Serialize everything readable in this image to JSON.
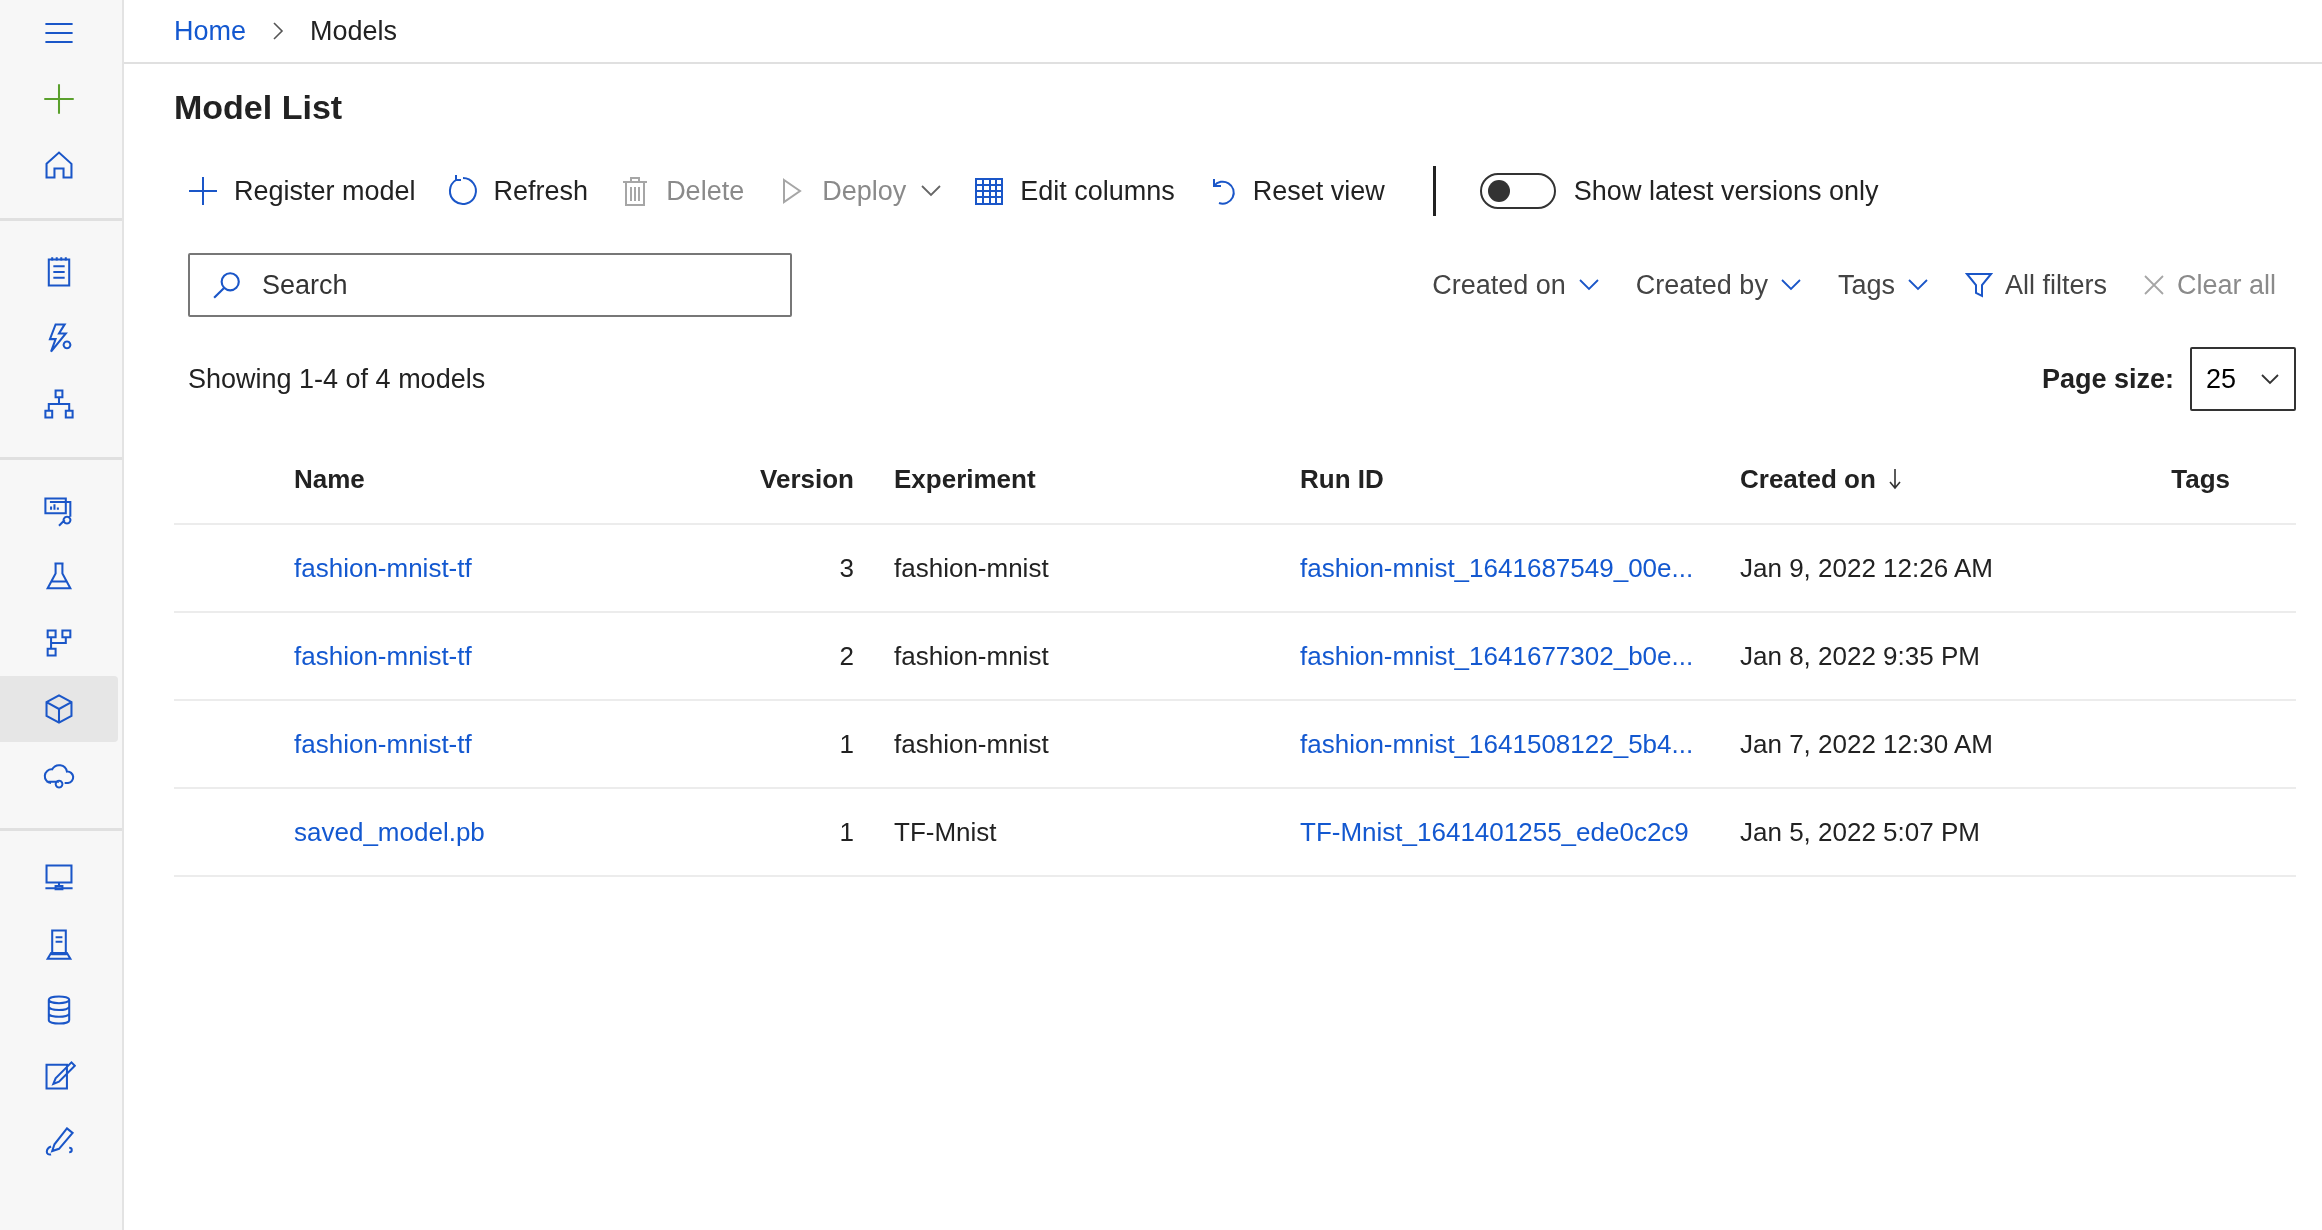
{
  "sidebar": {
    "groups": [
      {
        "items": [
          {
            "selected": false
          },
          {
            "selected": false
          },
          {
            "selected": false
          }
        ]
      },
      {
        "items": [
          {
            "selected": false
          },
          {
            "selected": false
          },
          {
            "selected": false
          }
        ]
      },
      {
        "items": [
          {
            "selected": false
          },
          {
            "selected": false
          },
          {
            "selected": false
          },
          {
            "selected": true
          },
          {
            "selected": false
          }
        ]
      },
      {
        "items": [
          {
            "selected": false
          },
          {
            "selected": false
          },
          {
            "selected": false
          },
          {
            "selected": false
          },
          {
            "selected": false
          }
        ]
      }
    ]
  },
  "breadcrumb": [
    "Home",
    "Models"
  ],
  "page_title": "Model List",
  "toolbar": [
    {
      "kind": "add",
      "label": "Register model",
      "disabled": false,
      "dropdown": false
    },
    {
      "kind": "refresh",
      "label": "Refresh",
      "disabled": false,
      "dropdown": false
    },
    {
      "kind": "delete",
      "label": "Delete",
      "disabled": true,
      "dropdown": false
    },
    {
      "kind": "deploy",
      "label": "Deploy",
      "disabled": true,
      "dropdown": true
    },
    {
      "kind": "columns",
      "label": "Edit columns",
      "disabled": false,
      "dropdown": false
    },
    {
      "kind": "reset",
      "label": "Reset view",
      "disabled": false,
      "dropdown": false
    }
  ],
  "toggle": {
    "label": "Show latest versions only",
    "on": false
  },
  "search": {
    "placeholder": "Search"
  },
  "filters": [
    {
      "kind": "dropdown",
      "label": "Created on",
      "disabled": false
    },
    {
      "kind": "dropdown",
      "label": "Created by",
      "disabled": false
    },
    {
      "kind": "dropdown",
      "label": "Tags",
      "disabled": false
    },
    {
      "kind": "filter",
      "label": "All filters",
      "disabled": false
    },
    {
      "kind": "clear",
      "label": "Clear all",
      "disabled": true
    }
  ],
  "summary": "Showing 1-4 of 4 models",
  "page_size": {
    "label": "Page size:",
    "value": "25"
  },
  "table": {
    "columns": [
      {
        "label": "Name",
        "sorted": false
      },
      {
        "label": "Version",
        "sorted": false
      },
      {
        "label": "Experiment",
        "sorted": false
      },
      {
        "label": "Run ID",
        "sorted": false
      },
      {
        "label": "Created on",
        "sorted": true
      },
      {
        "label": "Tags",
        "sorted": false
      }
    ],
    "rows": [
      {
        "name": "fashion-mnist-tf",
        "version": "3",
        "experiment": "fashion-mnist",
        "run_id": "fashion-mnist_1641687549_00e...",
        "created_on": "Jan 9, 2022 12:26 AM"
      },
      {
        "name": "fashion-mnist-tf",
        "version": "2",
        "experiment": "fashion-mnist",
        "run_id": "fashion-mnist_1641677302_b0e...",
        "created_on": "Jan 8, 2022 9:35 PM"
      },
      {
        "name": "fashion-mnist-tf",
        "version": "1",
        "experiment": "fashion-mnist",
        "run_id": "fashion-mnist_1641508122_5b4...",
        "created_on": "Jan 7, 2022 12:30 AM"
      },
      {
        "name": "saved_model.pb",
        "version": "1",
        "experiment": "TF-Mnist",
        "run_id": "TF-Mnist_1641401255_ede0c2c9",
        "created_on": "Jan 5, 2022 5:07 PM"
      }
    ]
  }
}
